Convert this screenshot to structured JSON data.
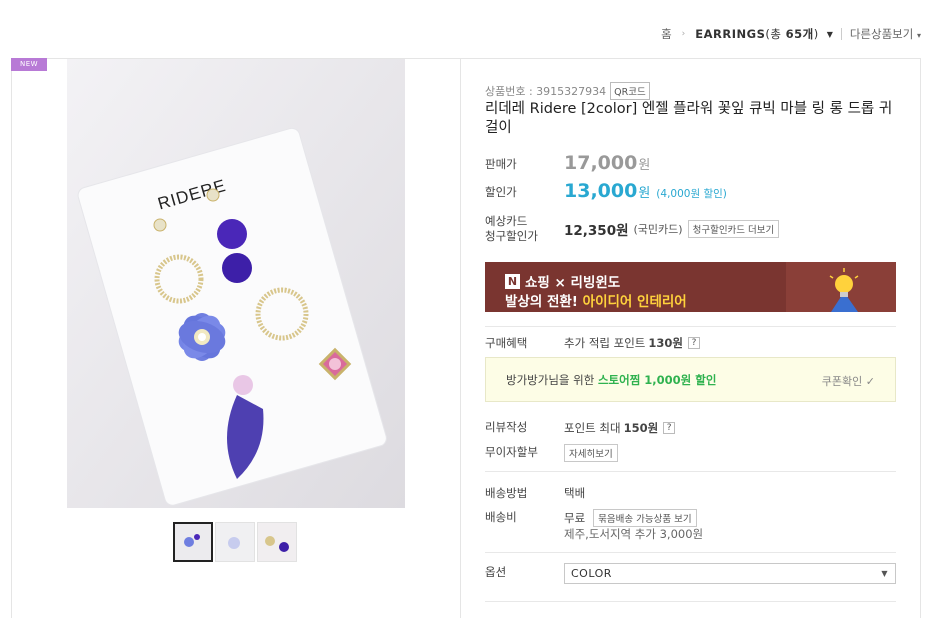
{
  "breadcrumb": {
    "home": "홈",
    "category_name": "EARRINGS",
    "category_count_prefix": "(총 ",
    "category_count": "65개",
    "category_count_suffix": ")",
    "other_products": "다른상품보기"
  },
  "badge": {
    "new": "NEW"
  },
  "product": {
    "id_label": "상품번호 : 3915327934",
    "qr_label": "QR코드",
    "title": "리데레 Ridere [2color] 엔젤 플라워 꽃잎 큐빅 마블 링 롱 드롭 귀걸이",
    "image_brand": "RIDERE"
  },
  "pricing": {
    "sale_label": "판매가",
    "sale_price": "17,000",
    "currency": "원",
    "discount_label": "할인가",
    "discount_price": "13,000",
    "discount_note": "(4,000원 할인)",
    "card_label_1": "예상카드",
    "card_label_2": "청구할인가",
    "card_price": "12,350원",
    "card_name": "(국민카드)",
    "card_more": "청구할인카드 더보기"
  },
  "banner": {
    "logo": "N",
    "line1": "쇼핑 × 리빙윈도",
    "line2_a": "발상의 전환! ",
    "line2_b": "아이디어 인테리어"
  },
  "benefit": {
    "label": "구매혜택",
    "text": "추가 적립 포인트",
    "amount": "130원",
    "help": "?"
  },
  "coupon": {
    "text": "방가방가님을 위한 ",
    "highlight": "스토어찜 1,000원 할인",
    "check": "쿠폰확인 ✓"
  },
  "review": {
    "label": "리뷰작성",
    "text": "포인트 최대",
    "amount": "150원",
    "help": "?"
  },
  "installment": {
    "label": "무이자할부",
    "button": "자세히보기"
  },
  "shipping": {
    "method_label": "배송방법",
    "method": "택배",
    "fee_label": "배송비",
    "fee": "무료",
    "fee_button": "묶음배송 가능상품 보기",
    "extra": "제주,도서지역 추가 3,000원"
  },
  "options": {
    "label": "옵션",
    "selected": "COLOR"
  },
  "colors": {
    "discount_blue": "#29a8d1",
    "coupon_green": "#2fb24f",
    "banner_bg": "#7a3530",
    "banner_highlight": "#ffd23c",
    "new_badge": "#b87ad6"
  }
}
